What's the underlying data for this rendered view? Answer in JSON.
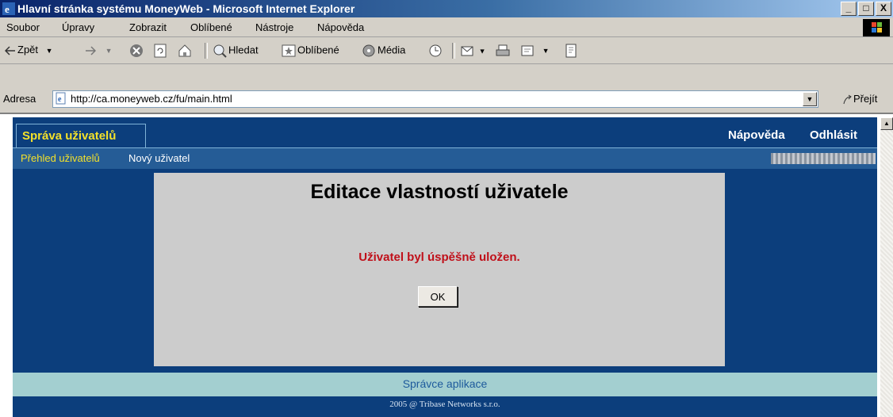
{
  "window": {
    "title": "Hlavní stránka systému MoneyWeb - Microsoft Internet Explorer",
    "minimize": "_",
    "maximize": "□",
    "close": "X"
  },
  "menu": [
    "Soubor",
    "Úpravy",
    "Zobrazit",
    "Oblíbené",
    "Nástroje",
    "Nápověda"
  ],
  "toolbar": {
    "back": "Zpět",
    "search": "Hledat",
    "favorites": "Oblíbené",
    "media": "Média"
  },
  "address": {
    "label": "Adresa",
    "url": "http://ca.moneyweb.cz/fu/main.html",
    "go": "Přejít"
  },
  "page": {
    "active_tab": "Správa uživatelů",
    "top_links": {
      "help": "Nápověda",
      "logout": "Odhlásit"
    },
    "subnav": {
      "overview": "Přehled uživatelů",
      "new_user": "Nový uživatel"
    },
    "content": {
      "title": "Editace vlastností uživatele",
      "message": "Uživatel byl úspěšně uložen.",
      "ok_button": "OK"
    },
    "footer_link": "Správce aplikace",
    "copyright": "2005 @ Tribase Networks s.r.o."
  },
  "colors": {
    "page_background": "#0c3e7c",
    "tab_text": "#f3e12a",
    "message_text": "#c0101a",
    "footer_background": "#a3cfd0"
  },
  "icons": [
    "ie-logo-icon",
    "windows-logo-icon",
    "back-arrow-icon",
    "forward-arrow-icon",
    "stop-icon",
    "refresh-icon",
    "home-icon",
    "search-icon",
    "favorites-icon",
    "media-icon",
    "history-icon",
    "mail-icon",
    "print-icon",
    "edit-icon",
    "discuss-icon",
    "page-icon",
    "go-arrow-icon",
    "scroll-up-icon"
  ]
}
